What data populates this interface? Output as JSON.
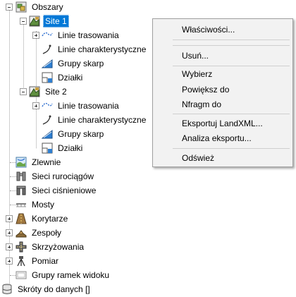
{
  "tree": {
    "obszary": "Obszary",
    "sites": [
      {
        "label": "Site 1",
        "children": [
          "Linie trasowania",
          "Linie charakterystyczne",
          "Grupy skarp",
          "Działki"
        ]
      },
      {
        "label": "Site 2",
        "children": [
          "Linie trasowania",
          "Linie charakterystyczne",
          "Grupy skarp",
          "Działki"
        ]
      }
    ],
    "top_items": [
      "Zlewnie",
      "Sieci rurociągów",
      "Sieci ciśnieniowe",
      "Mosty",
      "Korytarze",
      "Zespoły",
      "Skrzyżowania",
      "Pomiar",
      "Grupy ramek widoku"
    ],
    "shortcuts": "Skróty do danych []"
  },
  "context_menu": {
    "items": [
      "Właściwości...",
      "Usuń...",
      "Wybierz",
      "Powiększ do",
      "Nfragm do",
      "Eksportuj LandXML...",
      "Analiza eksportu...",
      "Odśwież"
    ]
  },
  "colors": {
    "selection": "#0078d7",
    "menu_background": "#f2f2f2"
  }
}
